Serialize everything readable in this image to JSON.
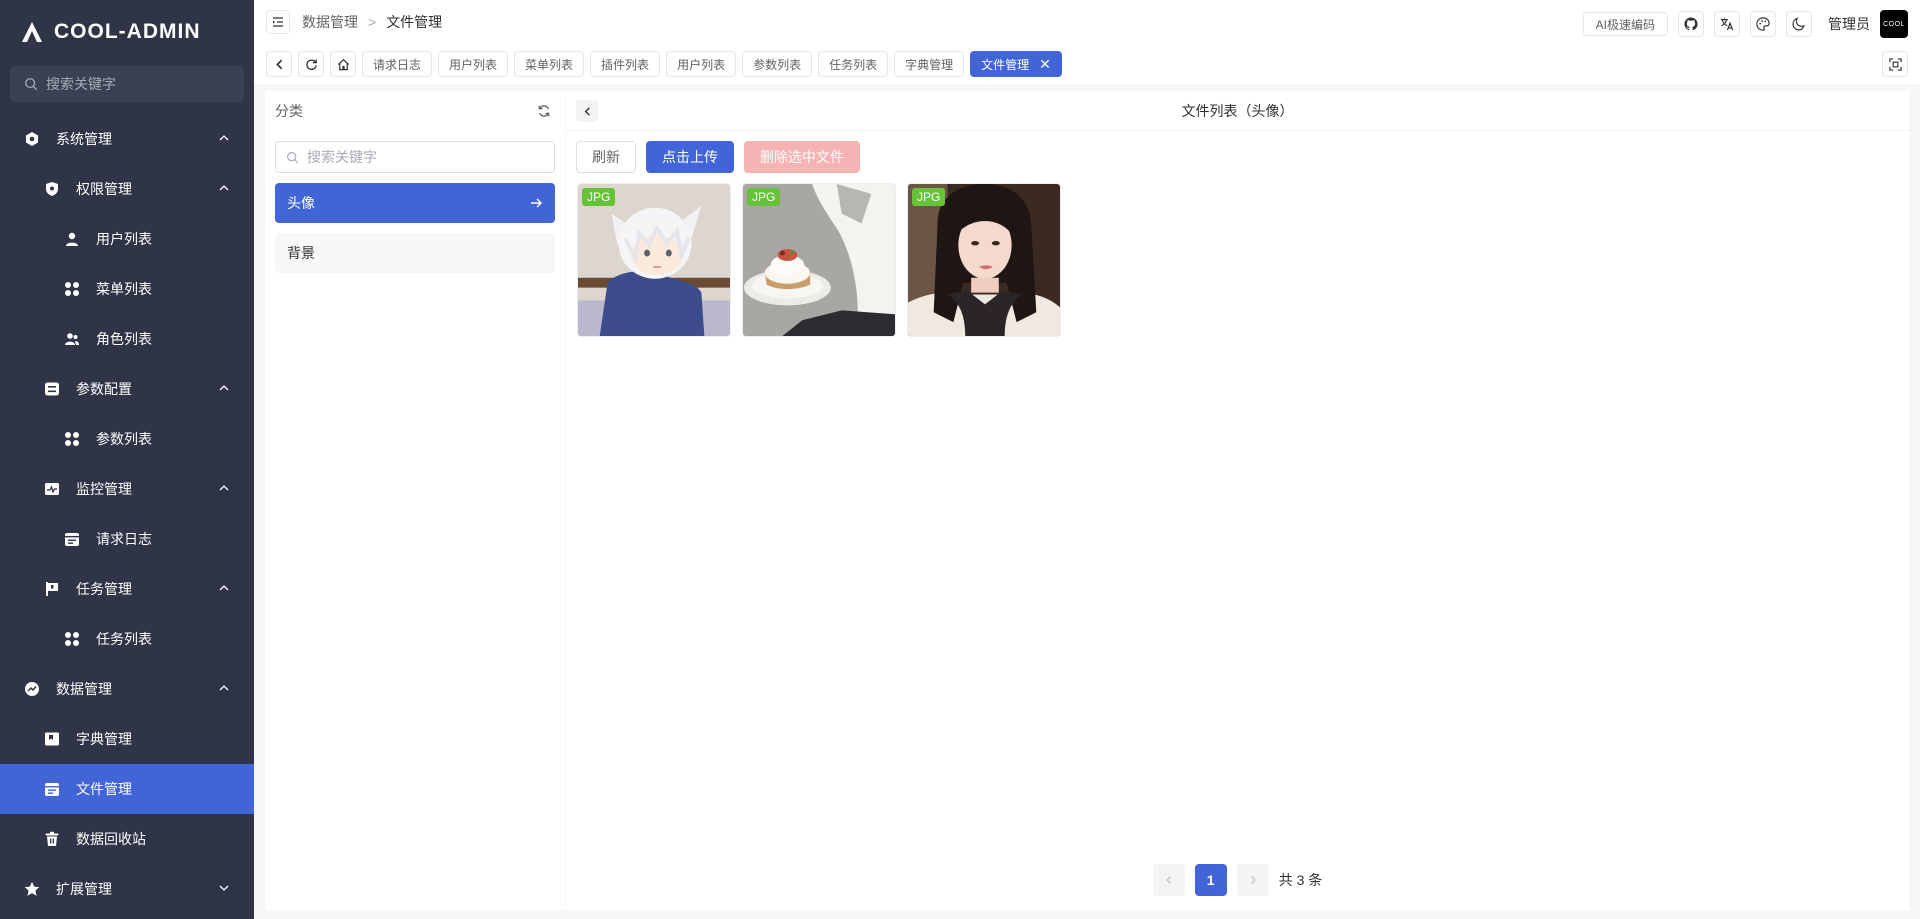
{
  "app": {
    "logo_text": "COOL-ADMIN",
    "search_placeholder": "搜索关键字"
  },
  "sidebar": {
    "items": [
      {
        "label": "系统管理",
        "icon": "settings-icon",
        "arrow": "up"
      },
      {
        "label": "权限管理",
        "icon": "shield-icon",
        "arrow": "up"
      },
      {
        "label": "用户列表",
        "icon": "user-icon"
      },
      {
        "label": "菜单列表",
        "icon": "grid-icon"
      },
      {
        "label": "角色列表",
        "icon": "users-icon"
      },
      {
        "label": "参数配置",
        "icon": "sliders-icon",
        "arrow": "up"
      },
      {
        "label": "参数列表",
        "icon": "grid-icon"
      },
      {
        "label": "监控管理",
        "icon": "monitor-icon",
        "arrow": "up"
      },
      {
        "label": "请求日志",
        "icon": "calendar-icon"
      },
      {
        "label": "任务管理",
        "icon": "flag-icon",
        "arrow": "up"
      },
      {
        "label": "任务列表",
        "icon": "grid-icon"
      },
      {
        "label": "数据管理",
        "icon": "chart-icon",
        "arrow": "up"
      },
      {
        "label": "字典管理",
        "icon": "book-icon"
      },
      {
        "label": "文件管理",
        "icon": "calendar-icon",
        "active": true
      },
      {
        "label": "数据回收站",
        "icon": "trash-icon"
      },
      {
        "label": "扩展管理",
        "icon": "star-icon",
        "arrow": "down"
      }
    ]
  },
  "header": {
    "breadcrumb": [
      "数据管理",
      "文件管理"
    ],
    "breadcrumb_sep": ">",
    "ai_button": "AI极速编码",
    "user_name": "管理员",
    "avatar_text": "COOL"
  },
  "tabs": [
    "请求日志",
    "用户列表",
    "菜单列表",
    "插件列表",
    "用户列表",
    "参数列表",
    "任务列表",
    "字典管理",
    "文件管理"
  ],
  "tab_close": "✕",
  "category": {
    "title": "分类",
    "search_placeholder": "搜索关键字",
    "items": [
      {
        "label": "头像",
        "active": true
      },
      {
        "label": "背景"
      }
    ]
  },
  "files": {
    "title": "文件列表（头像）",
    "refresh_label": "刷新",
    "upload_label": "点击上传",
    "delete_label": "删除选中文件",
    "items": [
      {
        "type": "JPG",
        "thumb": "anime-cat-boy"
      },
      {
        "type": "JPG",
        "thumb": "cake-plate"
      },
      {
        "type": "JPG",
        "thumb": "girl-portrait"
      }
    ],
    "pagination": {
      "current": "1",
      "total_text": "共 3 条"
    }
  },
  "colors": {
    "sidebar_bg": "#2f3447",
    "primary": "#4165d7",
    "badge_green": "#67c23a",
    "danger_light": "#f6b3b3"
  }
}
